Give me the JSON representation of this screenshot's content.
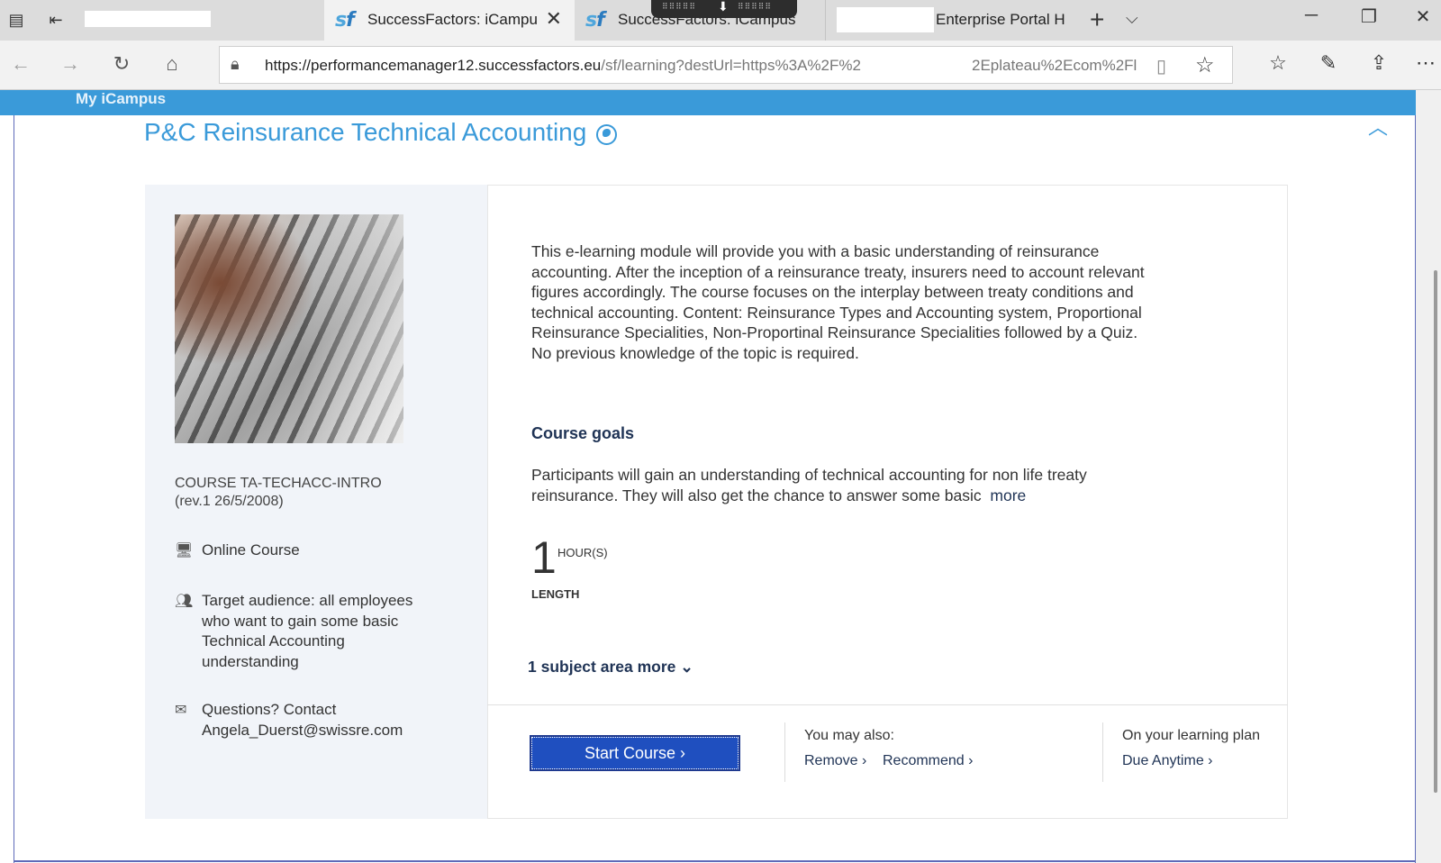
{
  "browser": {
    "tabs": [
      {
        "title": "",
        "redacted": true
      },
      {
        "title": "SuccessFactors: iCampu",
        "active": true,
        "favicon": "sf"
      },
      {
        "title": "SuccessFactors: iCampus",
        "favicon": "sf"
      },
      {
        "title": "Enterprise Portal H"
      }
    ],
    "url_host": "https://performancemanager12.successfactors.eu",
    "url_path": "/sf/learning?destUrl=https%3A%2F%2",
    "url_tail": "2Eplateau%2Ecom%2Fl",
    "icons": {
      "back": "back-arrow-icon",
      "forward": "forward-arrow-icon",
      "refresh": "refresh-icon",
      "home": "home-icon",
      "lock": "lock-icon",
      "reader": "reading-view-icon",
      "favorite": "star-icon"
    }
  },
  "site": {
    "name": "My iCampus"
  },
  "course": {
    "title": "P&C Reinsurance Technical Accounting",
    "code": "COURSE TA-TECHACC-INTRO",
    "revision": "(rev.1 26/5/2008)",
    "type": "Online Course",
    "audience_lines": [
      "Target audience: all employees",
      "who want to gain some basic",
      "Technical Accounting",
      "understanding"
    ],
    "contact_lines": [
      "Questions? Contact",
      "Angela_Duerst@swissre.com"
    ],
    "description_lines": [
      "This e-learning module will provide you with a basic understanding of reinsurance",
      "accounting. After the inception of a reinsurance treaty, insurers need to account relevant",
      "figures accordingly. The course focuses on the interplay between treaty conditions and",
      "technical accounting. Content: Reinsurance Types and Accounting system, Proportional",
      "Reinsurance Specialities, Non-Proportinal Reinsurance Specialities followed by a Quiz.",
      "No previous knowledge of the topic is required."
    ],
    "goals_heading": "Course goals",
    "goals_lines": [
      "Participants will gain an understanding of technical accounting for non life treaty",
      "reinsurance. They will also get the chance to answer some basic"
    ],
    "goals_more": "more",
    "length_value": "1",
    "length_unit": "HOUR(S)",
    "length_label": "LENGTH",
    "subject_area": "1 subject area more"
  },
  "actions": {
    "start": "Start Course",
    "you_may_also": "You may also:",
    "remove": "Remove",
    "recommend": "Recommend",
    "plan_label": "On your learning plan",
    "due": "Due Anytime"
  },
  "colors": {
    "accent": "#3a9ad9",
    "button": "#1f4fbf",
    "dark_text": "#1f3355",
    "left_panel": "#f1f4f9"
  }
}
